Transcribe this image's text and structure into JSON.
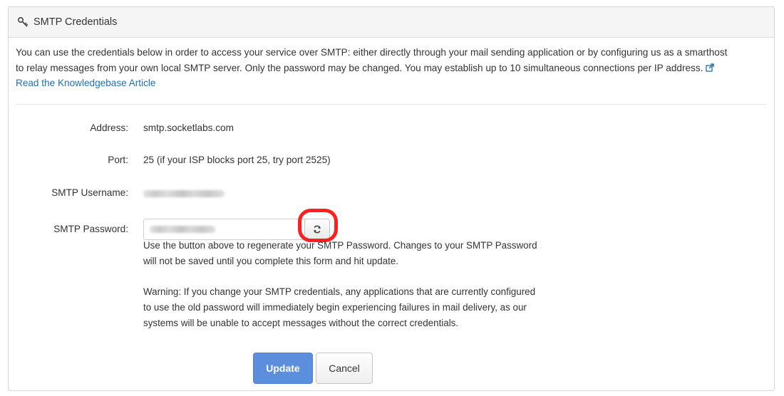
{
  "panel": {
    "title": "SMTP Credentials",
    "title_icon": "key-icon",
    "intro_text": "You can use the credentials below in order to access your service over SMTP: either directly through your mail sending application or by configuring us as a smarthost to relay messages from your own local SMTP server. Only the password may be changed. You may establish up to 10 simultaneous connections per IP address.",
    "kb_link": "Read the Knowledgebase Article",
    "kb_link_icon": "external-link-icon"
  },
  "fields": {
    "address_label": "Address:",
    "address_value": "smtp.socketlabs.com",
    "port_label": "Port:",
    "port_value": "25 (if your ISP blocks port 25, try port 2525)",
    "username_label": "SMTP Username:",
    "username_value": "(redacted)",
    "password_label": "SMTP Password:",
    "password_value": "(redacted)",
    "regenerate_icon": "refresh-icon"
  },
  "help": {
    "regenerate_text": "Use the button above to regenerate your SMTP Password. Changes to your SMTP Password will not be saved until you complete this form and hit update.",
    "warning_text": "Warning: If you change your SMTP credentials, any applications that are currently configured to use the old password will immediately begin experiencing failures in mail delivery, as our systems will be unable to accept messages without the correct credentials."
  },
  "actions": {
    "update_label": "Update",
    "cancel_label": "Cancel"
  },
  "colors": {
    "highlight": "#ff1f1f",
    "primary_button": "#5b8fdd",
    "link": "#1e6fb5"
  }
}
